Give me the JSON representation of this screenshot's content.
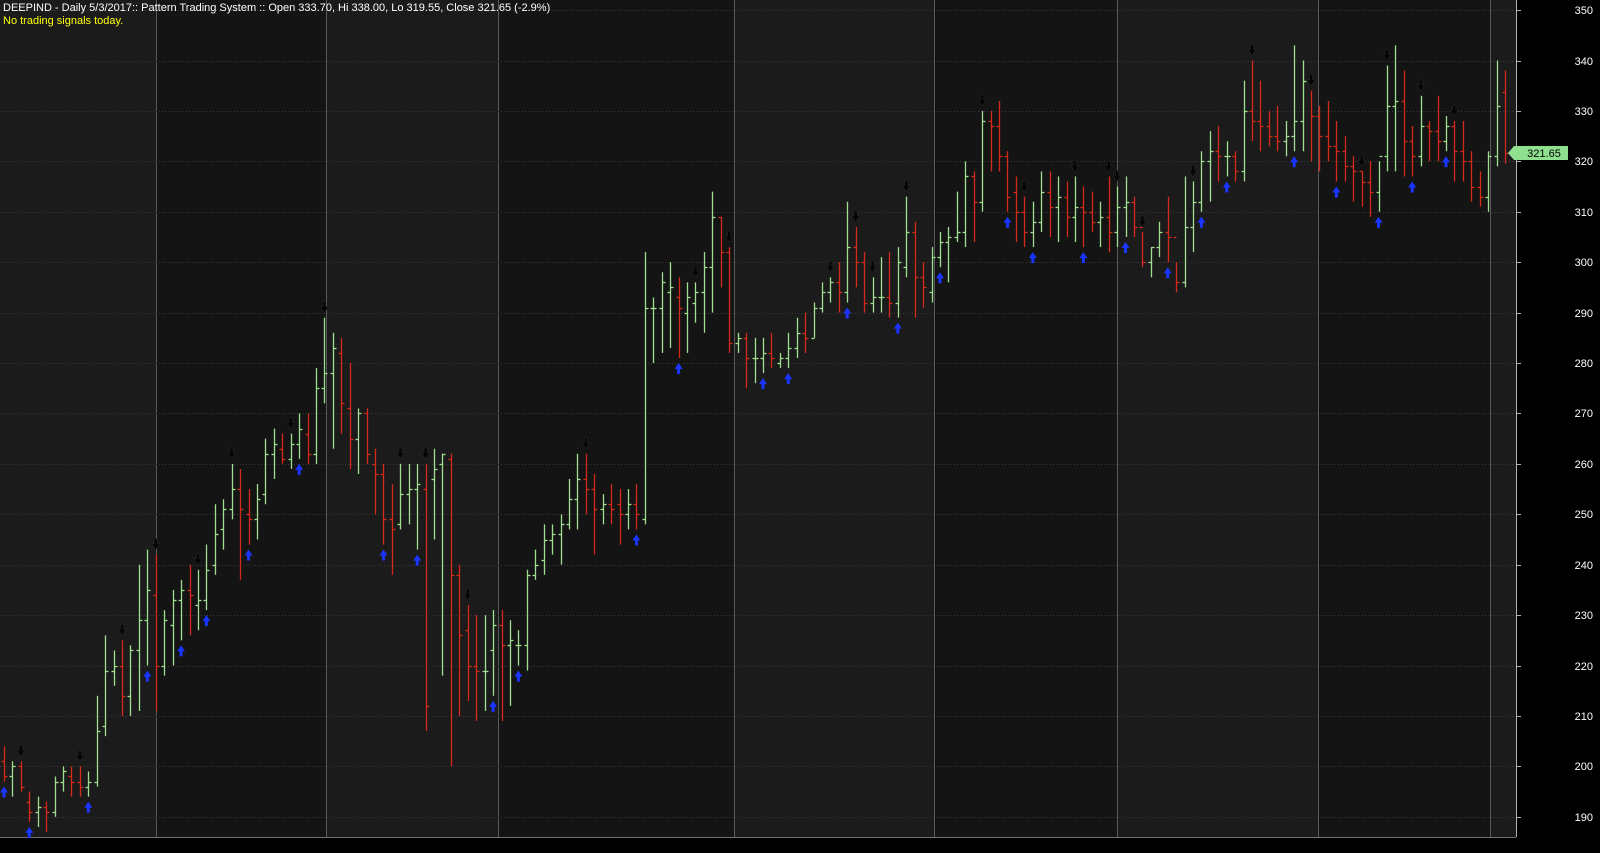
{
  "header": {
    "title": "DEEPIND - Daily 5/3/2017:: Pattern Trading System :: Open 333.70, Hi 338.00, Lo 319.55, Close 321.65 (-2.9%)",
    "status": "No trading signals today."
  },
  "colors": {
    "background": "#000000",
    "panel_light": "#1b1b1b",
    "panel_dark": "#141414",
    "grid": "#3a3a3a",
    "separator": "#5a5a5a",
    "up_bar": "#9fdf8f",
    "down_bar": "#d42a1a",
    "buy_arrow": "#1a35ff",
    "sell_arrow": "#050505",
    "axis_text": "#ffffff",
    "last_price_bg": "#8fe08f",
    "title_text": "#ffffff",
    "status_text": "#ffff00"
  },
  "chart_data": {
    "type": "ohlc",
    "ylim": [
      186,
      352
    ],
    "yticks": [
      190,
      200,
      210,
      220,
      230,
      240,
      250,
      260,
      270,
      280,
      290,
      300,
      310,
      320,
      330,
      340,
      350
    ],
    "last_price_label": "321.65",
    "last_price_value": 321.65,
    "bars": [
      [
        201,
        204,
        197,
        198
      ],
      [
        198,
        201,
        194,
        200
      ],
      [
        200,
        201,
        195,
        196
      ],
      [
        193,
        195,
        189,
        191
      ],
      [
        191,
        194,
        188,
        192
      ],
      [
        192,
        193,
        187,
        191
      ],
      [
        191,
        198,
        190,
        197
      ],
      [
        197,
        200,
        195,
        199
      ],
      [
        198,
        200,
        194,
        197
      ],
      [
        197,
        200,
        194,
        196
      ],
      [
        196,
        199,
        194,
        197
      ],
      [
        197,
        214,
        196,
        207
      ],
      [
        208,
        226,
        206,
        219
      ],
      [
        219,
        223,
        216,
        220
      ],
      [
        220,
        225,
        210,
        214
      ],
      [
        214,
        224,
        210,
        223
      ],
      [
        223,
        240,
        211,
        229
      ],
      [
        229,
        243,
        220,
        235
      ],
      [
        234,
        242,
        211,
        220
      ],
      [
        220,
        231,
        218,
        229
      ],
      [
        228,
        235,
        220,
        233
      ],
      [
        233,
        237,
        225,
        235
      ],
      [
        235,
        240,
        226,
        234
      ],
      [
        232,
        239,
        227,
        233
      ],
      [
        233,
        244,
        231,
        239
      ],
      [
        240,
        252,
        238,
        246
      ],
      [
        247,
        253,
        243,
        251
      ],
      [
        251,
        260,
        249,
        255
      ],
      [
        255,
        259,
        237,
        251
      ],
      [
        250,
        255,
        244,
        249
      ],
      [
        249,
        256,
        245,
        253
      ],
      [
        254,
        265,
        252,
        262
      ],
      [
        262,
        267,
        257,
        264
      ],
      [
        263,
        266,
        260,
        261
      ],
      [
        261,
        266,
        259,
        264
      ],
      [
        264,
        270,
        261,
        267
      ],
      [
        266,
        270,
        260,
        262
      ],
      [
        262,
        279,
        260,
        275
      ],
      [
        275,
        289,
        272,
        278
      ],
      [
        278,
        286,
        263,
        283
      ],
      [
        282,
        285,
        266,
        272
      ],
      [
        271,
        280,
        259,
        265
      ],
      [
        265,
        271,
        258,
        270
      ],
      [
        270,
        271,
        260,
        262
      ],
      [
        260,
        263,
        250,
        258
      ],
      [
        258,
        260,
        244,
        249
      ],
      [
        249,
        256,
        238,
        247
      ],
      [
        248,
        260,
        247,
        254
      ],
      [
        254,
        260,
        248,
        255
      ],
      [
        255,
        260,
        243,
        256
      ],
      [
        255,
        260,
        207,
        212
      ],
      [
        257,
        263,
        245,
        259
      ],
      [
        260,
        262,
        218,
        262
      ],
      [
        261,
        262,
        200,
        238
      ],
      [
        238,
        240,
        210,
        226
      ],
      [
        227,
        232,
        213,
        220
      ],
      [
        220,
        230,
        209,
        219
      ],
      [
        219,
        230,
        211,
        219
      ],
      [
        223,
        231,
        214,
        228
      ],
      [
        228,
        231,
        209,
        224
      ],
      [
        224,
        229,
        212,
        225
      ],
      [
        224,
        227,
        220,
        224
      ],
      [
        224,
        239,
        219,
        238
      ],
      [
        238,
        243,
        237,
        240
      ],
      [
        241,
        248,
        238,
        245
      ],
      [
        245,
        248,
        242,
        246
      ],
      [
        246,
        250,
        240,
        248
      ],
      [
        248,
        257,
        247,
        253
      ],
      [
        253,
        262,
        247,
        257
      ],
      [
        257,
        262,
        250,
        255
      ],
      [
        255,
        258,
        242,
        251
      ],
      [
        251,
        254,
        248,
        252
      ],
      [
        252,
        256,
        248,
        251
      ],
      [
        252,
        255,
        244,
        250
      ],
      [
        250,
        255,
        247,
        252
      ],
      [
        252,
        256,
        247,
        250
      ],
      [
        249,
        302,
        248,
        291
      ],
      [
        291,
        293,
        280,
        291
      ],
      [
        291,
        298,
        282,
        296
      ],
      [
        294,
        300,
        283,
        295
      ],
      [
        293,
        297,
        281,
        291
      ],
      [
        290,
        296,
        282,
        293
      ],
      [
        292,
        296,
        288,
        294
      ],
      [
        294,
        302,
        286,
        299
      ],
      [
        299,
        314,
        290,
        309
      ],
      [
        309,
        309,
        295,
        302
      ],
      [
        302,
        303,
        282,
        284
      ],
      [
        284,
        286,
        282,
        285
      ],
      [
        285,
        286,
        275,
        281
      ],
      [
        281,
        285,
        276,
        281
      ],
      [
        281,
        285,
        278,
        282
      ],
      [
        282,
        286,
        279,
        281
      ],
      [
        280,
        282,
        279,
        281
      ],
      [
        281,
        286,
        279,
        283
      ],
      [
        283,
        289,
        281,
        286
      ],
      [
        286,
        290,
        282,
        285
      ],
      [
        285,
        292,
        285,
        291
      ],
      [
        291,
        296,
        290,
        294
      ],
      [
        294,
        297,
        292,
        296
      ],
      [
        296,
        300,
        290,
        294
      ],
      [
        294,
        312,
        292,
        303
      ],
      [
        303,
        307,
        295,
        300
      ],
      [
        300,
        302,
        290,
        292
      ],
      [
        292,
        297,
        290,
        293
      ],
      [
        293,
        301,
        290,
        293
      ],
      [
        293,
        302,
        289,
        292
      ],
      [
        292,
        303,
        289,
        300
      ],
      [
        299,
        313,
        297,
        306
      ],
      [
        306,
        308,
        289,
        297
      ],
      [
        297,
        300,
        291,
        295
      ],
      [
        294,
        303,
        292,
        301
      ],
      [
        301,
        306,
        299,
        304
      ],
      [
        304,
        307,
        296,
        305
      ],
      [
        305,
        314,
        304,
        306
      ],
      [
        306,
        320,
        303,
        317
      ],
      [
        317,
        318,
        304,
        312
      ],
      [
        312,
        330,
        310,
        328
      ],
      [
        328,
        330,
        318,
        327
      ],
      [
        327,
        332,
        318,
        321
      ],
      [
        321,
        322,
        310,
        313
      ],
      [
        314,
        317,
        304,
        310
      ],
      [
        310,
        313,
        303,
        306
      ],
      [
        306,
        312,
        303,
        308
      ],
      [
        308,
        318,
        306,
        314
      ],
      [
        314,
        318,
        305,
        311
      ],
      [
        311,
        317,
        304,
        313
      ],
      [
        313,
        316,
        305,
        309
      ],
      [
        309,
        317,
        304,
        311
      ],
      [
        311,
        315,
        303,
        310
      ],
      [
        310,
        314,
        306,
        308
      ],
      [
        308,
        312,
        303,
        309
      ],
      [
        309,
        317,
        302,
        306
      ],
      [
        306,
        315,
        303,
        311
      ],
      [
        311,
        317,
        305,
        312
      ],
      [
        312,
        313,
        305,
        307
      ],
      [
        307,
        306,
        299,
        300
      ],
      [
        300,
        303,
        297,
        303
      ],
      [
        303,
        308,
        301,
        306
      ],
      [
        306,
        313,
        300,
        305
      ],
      [
        305,
        300,
        294,
        296
      ],
      [
        296,
        317,
        295,
        307
      ],
      [
        307,
        316,
        302,
        312
      ],
      [
        312,
        322,
        310,
        320
      ],
      [
        320,
        326,
        312,
        322
      ],
      [
        322,
        327,
        316,
        321
      ],
      [
        321,
        324,
        317,
        321
      ],
      [
        321,
        322,
        316,
        318
      ],
      [
        318,
        336,
        316,
        330
      ],
      [
        330,
        340,
        324,
        328
      ],
      [
        328,
        336,
        322,
        327
      ],
      [
        327,
        330,
        323,
        325
      ],
      [
        325,
        331,
        322,
        324
      ],
      [
        324,
        328,
        321,
        325
      ],
      [
        325,
        343,
        322,
        328
      ],
      [
        328,
        340,
        322,
        336
      ],
      [
        336,
        334,
        320,
        329
      ],
      [
        329,
        331,
        318,
        325
      ],
      [
        325,
        332,
        320,
        323
      ],
      [
        323,
        328,
        316,
        322
      ],
      [
        322,
        325,
        316,
        319
      ],
      [
        319,
        321,
        312,
        318
      ],
      [
        318,
        318,
        311,
        316
      ],
      [
        316,
        320,
        309,
        314
      ],
      [
        314,
        320,
        310,
        321
      ],
      [
        321,
        339,
        318,
        331
      ],
      [
        331,
        343,
        318,
        332
      ],
      [
        332,
        338,
        317,
        324
      ],
      [
        324,
        327,
        317,
        321
      ],
      [
        321,
        333,
        319,
        327
      ],
      [
        327,
        328,
        320,
        326
      ],
      [
        326,
        333,
        320,
        324
      ],
      [
        324,
        329,
        322,
        327
      ],
      [
        327,
        328,
        316,
        322
      ],
      [
        322,
        328,
        316,
        320
      ],
      [
        320,
        322,
        312,
        315
      ],
      [
        315,
        318,
        311,
        313
      ],
      [
        313,
        322,
        310,
        321
      ],
      [
        321,
        340,
        319,
        331
      ],
      [
        333.7,
        338,
        319.55,
        321.65
      ]
    ],
    "buy_signals": [
      0,
      3,
      10,
      17,
      21,
      24,
      29,
      35,
      45,
      49,
      58,
      61,
      75,
      80,
      90,
      93,
      100,
      106,
      111,
      119,
      122,
      128,
      133,
      138,
      142,
      145,
      153,
      158,
      163,
      167,
      171
    ],
    "sell_signals": [
      2,
      9,
      14,
      18,
      23,
      27,
      34,
      38,
      47,
      50,
      55,
      69,
      82,
      86,
      98,
      101,
      103,
      107,
      116,
      121,
      127,
      131,
      132,
      135,
      141,
      148,
      155,
      161,
      164,
      168,
      172
    ]
  }
}
